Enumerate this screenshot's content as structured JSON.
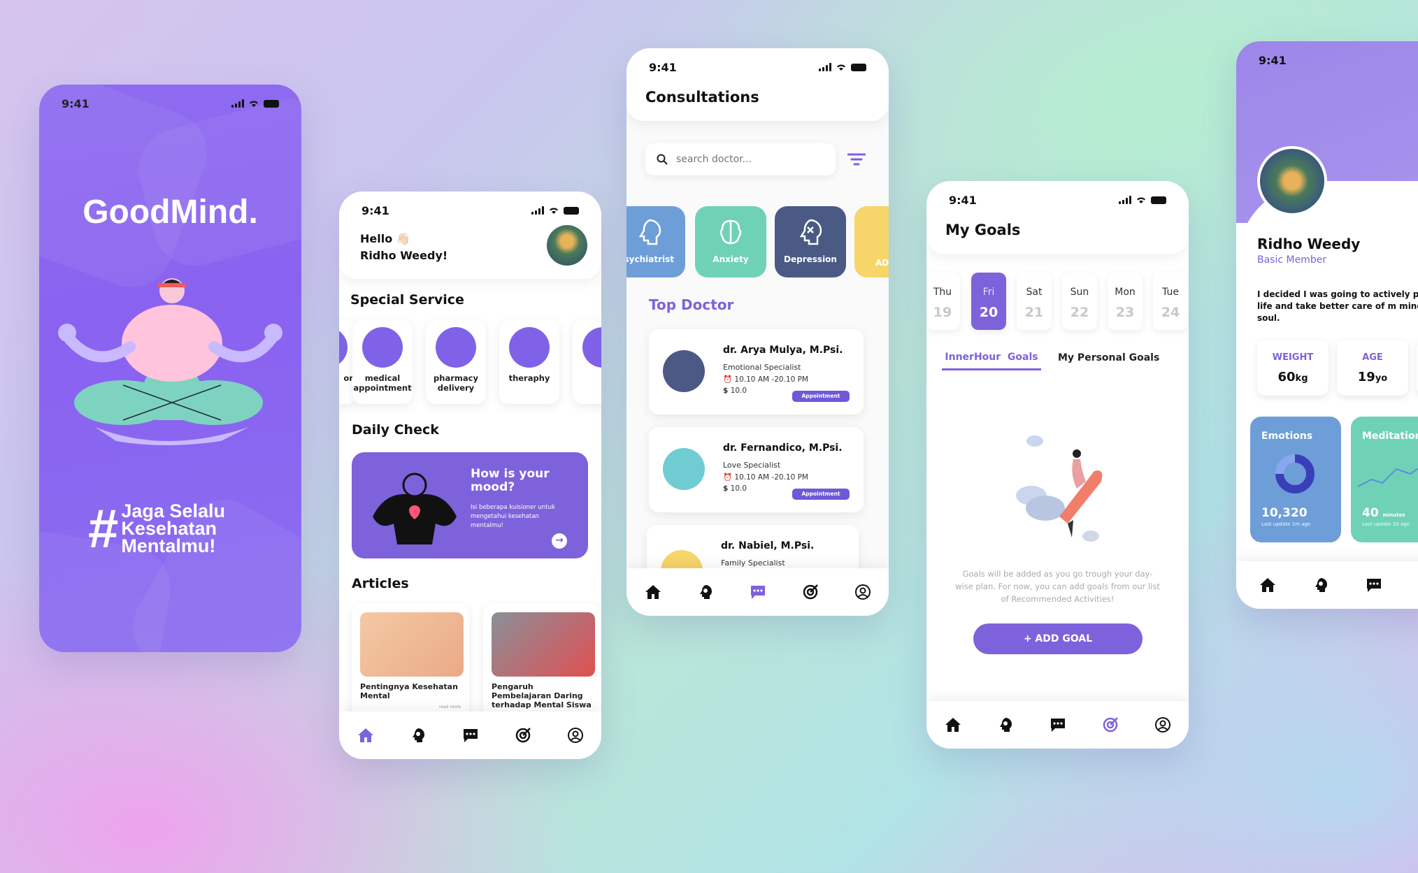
{
  "status_time": "9:41",
  "splash": {
    "title": "GoodMind.",
    "hash": "#",
    "tagline_1": "Jaga Selalu",
    "tagline_2": "Kesehatan",
    "tagline_3": "Mentalmu!"
  },
  "home": {
    "greeting": "Hello 👋🏻",
    "name": "Ridho Weedy!",
    "special_title": "Special Service",
    "services": [
      {
        "label": "or"
      },
      {
        "label": "medical appointment"
      },
      {
        "label": "pharmacy delivery"
      },
      {
        "label": "theraphy"
      }
    ],
    "daily_title": "Daily Check",
    "mood_title": "How is your mood?",
    "mood_desc": "Isi beberapa kuisioner untuk mengetahui kesehatan mentalmu!",
    "articles_title": "Articles",
    "articles": [
      {
        "title": "Pentingnya Kesehatan Mental",
        "more": "read more"
      },
      {
        "title": "Pengaruh Pembelajaran Daring terhadap Mental Siswa"
      }
    ]
  },
  "consult": {
    "title": "Consultations",
    "search_placeholder": "search doctor...",
    "categories": [
      {
        "label": "Psychiatrist",
        "color": "#6e9ed8"
      },
      {
        "label": "Anxiety",
        "color": "#6fd2b6"
      },
      {
        "label": "Depression",
        "color": "#4a5a85"
      },
      {
        "label": "AD",
        "color": "#f6d56a"
      }
    ],
    "top_title": "Top Doctor",
    "doctors": [
      {
        "name": "dr. Arya Mulya, M.Psi.",
        "spec": "Emotional Specialist",
        "time": "10.10 AM -20.10 PM",
        "price": "10.0",
        "color": "#4a5a85",
        "action": "Appointment"
      },
      {
        "name": "dr. Fernandico, M.Psi.",
        "spec": "Love Specialist",
        "time": "10.10 AM -20.10 PM",
        "price": "10.0",
        "color": "#6fccd2",
        "action": "Appointment"
      },
      {
        "name": "dr. Nabiel, M.Psi.",
        "spec": "Family Specialist",
        "color": "#f6d56a"
      }
    ]
  },
  "goals": {
    "title": "My Goals",
    "days": [
      {
        "dn": "Thu",
        "dd": "19"
      },
      {
        "dn": "Fri",
        "dd": "20",
        "active": true
      },
      {
        "dn": "Sat",
        "dd": "21"
      },
      {
        "dn": "Sun",
        "dd": "22"
      },
      {
        "dn": "Mon",
        "dd": "23"
      },
      {
        "dn": "Tue",
        "dd": "24"
      }
    ],
    "tab1": "InnerHour  Goals",
    "tab2": "My Personal Goals",
    "empty_text": "Goals will be added as you go trough your day-wise plan. For now, you can add goals from our list of Recommended Activities!",
    "add_button": "+ ADD GOAL"
  },
  "profile": {
    "name": "Ridho Weedy",
    "role": "Basic Member",
    "bio": "I decided I was going to actively persu life and take better care of m mind, be soul.",
    "weight_label": "WEIGHT",
    "weight_value": "60",
    "weight_unit": "kg",
    "age_label": "AGE",
    "age_value": "19",
    "age_unit": "yo",
    "emotions_label": "Emotions",
    "emotions_value": "10,320",
    "emotions_sub": "Last update 1m ago",
    "meditation_label": "Meditation",
    "meditation_value": "40",
    "meditation_unit": "minutes",
    "meditation_sub": "Last update 2d ago"
  },
  "colors": {
    "accent": "#7e62db",
    "splash": "#8b68f0",
    "green": "#6fd2b6"
  }
}
